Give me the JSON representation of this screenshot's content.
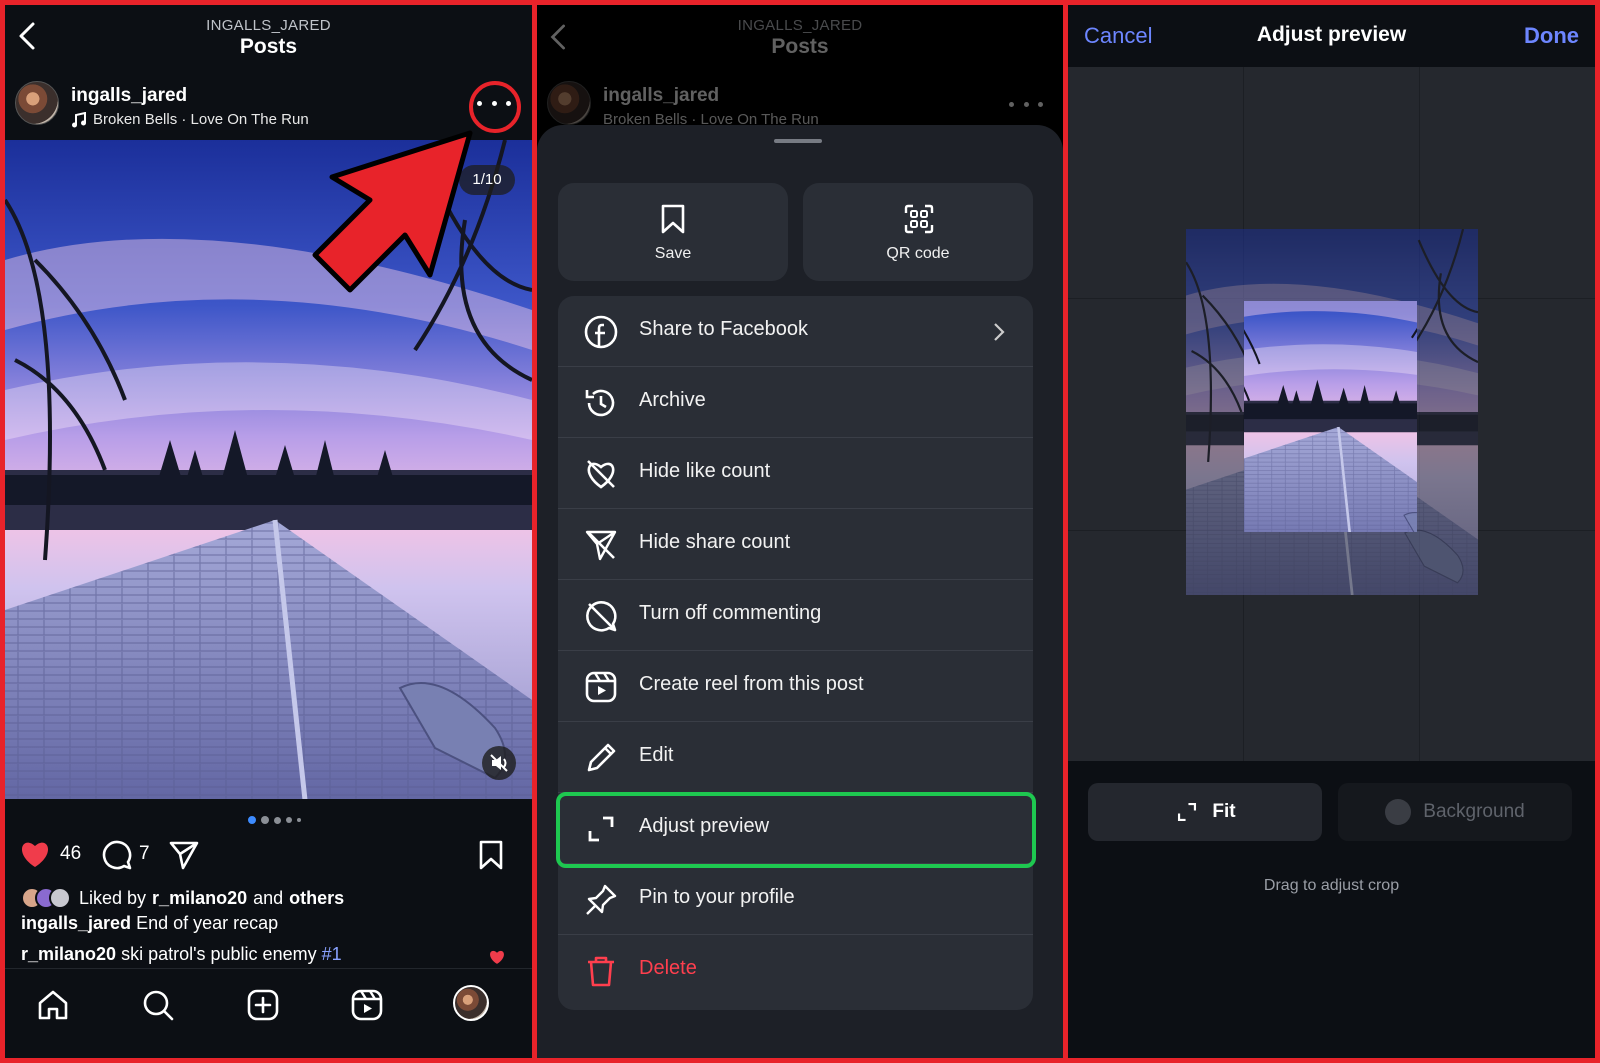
{
  "colors": {
    "annotation_red": "#e8232a",
    "annotation_green": "#1ec850",
    "link_blue": "#6d86ff",
    "danger": "#ff3f4e",
    "like_red": "#f03c4b"
  },
  "feed": {
    "header_subtitle": "INGALLS_JARED",
    "header_title": "Posts",
    "username": "ingalls_jared",
    "song": "Broken Bells · Love On The Run",
    "media_counter": "1/10",
    "like_count": "46",
    "comment_count": "7",
    "liked_by_prefix": "Liked by",
    "liked_by_user": "r_milano20",
    "liked_by_and": "and",
    "liked_by_others": "others",
    "caption_user": "ingalls_jared",
    "caption_text": "End of year recap",
    "comment_user": "r_milano20",
    "comment_text": "ski patrol's public enemy",
    "comment_hashtag": "#1",
    "pager": {
      "count": 5,
      "active": 0
    },
    "icons": [
      "back-icon",
      "more-icon",
      "heart-icon",
      "comment-icon",
      "share-icon",
      "bookmark-icon",
      "mute-icon",
      "home-icon",
      "search-icon",
      "create-icon",
      "reels-icon",
      "profile-avatar"
    ]
  },
  "sheet": {
    "dim_header_subtitle": "INGALLS_JARED",
    "dim_header_title": "Posts",
    "dim_username": "ingalls_jared",
    "dim_song": "Broken Bells · Love On The Run",
    "tiles": [
      {
        "label": "Save",
        "icon": "bookmark-icon"
      },
      {
        "label": "QR code",
        "icon": "qr-code-icon"
      }
    ],
    "items": [
      {
        "label": "Share to Facebook",
        "icon": "facebook-icon",
        "chevron": true
      },
      {
        "label": "Archive",
        "icon": "archive-icon"
      },
      {
        "label": "Hide like count",
        "icon": "hide-like-icon"
      },
      {
        "label": "Hide share count",
        "icon": "hide-share-icon"
      },
      {
        "label": "Turn off commenting",
        "icon": "comment-off-icon"
      },
      {
        "label": "Create reel from this post",
        "icon": "reel-icon"
      },
      {
        "label": "Edit",
        "icon": "pencil-icon"
      },
      {
        "label": "Adjust preview",
        "icon": "expand-icon",
        "highlighted": true
      },
      {
        "label": "Pin to your profile",
        "icon": "pin-icon"
      },
      {
        "label": "Delete",
        "icon": "trash-icon",
        "danger": true
      }
    ]
  },
  "adjust": {
    "cancel": "Cancel",
    "title": "Adjust preview",
    "done": "Done",
    "fit_label": "Fit",
    "background_label": "Background",
    "hint": "Drag to adjust crop"
  }
}
